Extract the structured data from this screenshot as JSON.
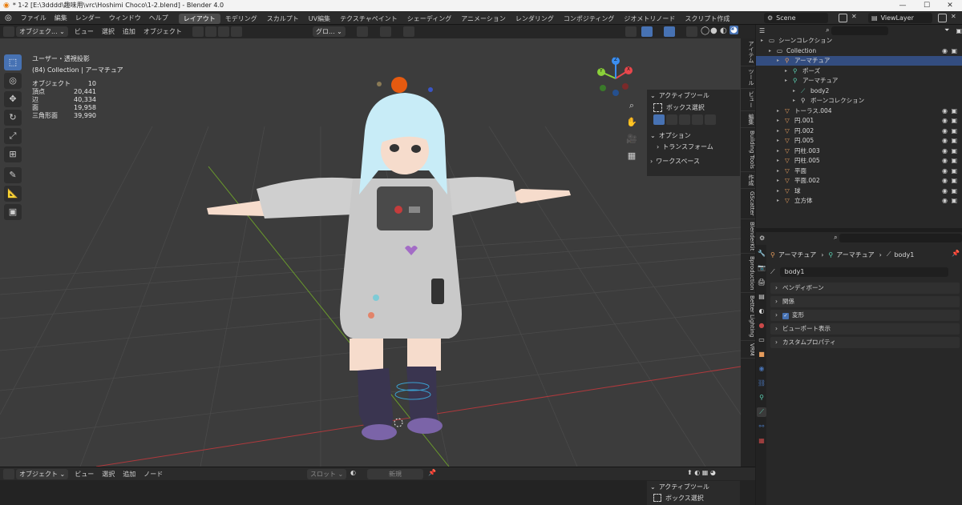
{
  "window": {
    "title": "* 1-2 [E:\\3dddd\\趣味用\\vrc\\Hoshimi Choco\\1-2.blend] - Blender 4.0",
    "minimize": "—",
    "maximize": "☐",
    "close": "✕"
  },
  "menu": [
    "ファイル",
    "編集",
    "レンダー",
    "ウィンドウ",
    "ヘルプ"
  ],
  "workspaces": [
    "レイアウト",
    "モデリング",
    "スカルプト",
    "UV編集",
    "テクスチャペイント",
    "シェーディング",
    "アニメーション",
    "レンダリング",
    "コンポジティング",
    "ジオメトリノード",
    "スクリプト作成"
  ],
  "active_workspace": "レイアウト",
  "scene": {
    "name": "Scene",
    "view_layer": "ViewLayer"
  },
  "viewport_header": {
    "mode": "オブジェク...",
    "menus": [
      "ビュー",
      "選択",
      "追加",
      "オブジェクト"
    ],
    "orientation": "グロ...",
    "options_label": "オプション"
  },
  "overlay": {
    "view_name": "ユーザー・透視投影",
    "collection_line": "(84) Collection | アーマチュア",
    "stats": [
      {
        "label": "オブジェクト",
        "value": "10"
      },
      {
        "label": "頂点",
        "value": "20,441"
      },
      {
        "label": "辺",
        "value": "40,334"
      },
      {
        "label": "面",
        "value": "19,958"
      },
      {
        "label": "三角形面",
        "value": "39,990"
      }
    ]
  },
  "gizmo": {
    "x": "X",
    "y": "Y",
    "z": "Z"
  },
  "npanel": {
    "active_tool": "アクティブツール",
    "box_select": "ボックス選択",
    "options": "オプション",
    "transform": "トランスフォーム",
    "workspace": "ワークスペース"
  },
  "side_tabs": [
    "アイテム",
    "ツール",
    "ビュー",
    "編集",
    "Building Tools",
    "作成",
    "GScatter",
    "BlenderKit",
    "Bproduction",
    "Better Lighting",
    "VRM"
  ],
  "outliner": {
    "rows": [
      {
        "name": "シーンコレクション",
        "indent": 0,
        "icon": "▭",
        "icon_color": "#cfcfcf"
      },
      {
        "name": "Collection",
        "indent": 1,
        "icon": "▭",
        "icon_color": "#e0e0e0",
        "vis": true
      },
      {
        "name": "アーマチュア",
        "indent": 2,
        "icon": "⚲",
        "icon_color": "#e59c5c",
        "selected": true
      },
      {
        "name": "ポーズ",
        "indent": 3,
        "icon": "⚲",
        "icon_color": "#5dd2b4"
      },
      {
        "name": "アーマチュア",
        "indent": 3,
        "icon": "⚲",
        "icon_color": "#5dd2b4"
      },
      {
        "name": "body2",
        "indent": 4,
        "icon": "⟋",
        "icon_color": "#5dd2b4"
      },
      {
        "name": "ボーンコレクション",
        "indent": 4,
        "icon": "⚲",
        "icon_color": "#cfcfcf"
      },
      {
        "name": "トーラス.004",
        "indent": 2,
        "icon": "▽",
        "icon_color": "#e59c5c",
        "vis": true
      },
      {
        "name": "円.001",
        "indent": 2,
        "icon": "▽",
        "icon_color": "#e59c5c",
        "vis": true
      },
      {
        "name": "円.002",
        "indent": 2,
        "icon": "▽",
        "icon_color": "#e59c5c",
        "vis": true
      },
      {
        "name": "円.005",
        "indent": 2,
        "icon": "▽",
        "icon_color": "#e59c5c",
        "vis": true
      },
      {
        "name": "円柱.003",
        "indent": 2,
        "icon": "▽",
        "icon_color": "#e59c5c",
        "vis": true
      },
      {
        "name": "円柱.005",
        "indent": 2,
        "icon": "▽",
        "icon_color": "#e59c5c",
        "vis": true
      },
      {
        "name": "平面",
        "indent": 2,
        "icon": "▽",
        "icon_color": "#e59c5c",
        "vis": true
      },
      {
        "name": "平面.002",
        "indent": 2,
        "icon": "▽",
        "icon_color": "#e59c5c",
        "vis": true
      },
      {
        "name": "球",
        "indent": 2,
        "icon": "▽",
        "icon_color": "#e59c5c",
        "vis": true
      },
      {
        "name": "立方体",
        "indent": 2,
        "icon": "▽",
        "icon_color": "#e59c5c",
        "vis": true
      }
    ]
  },
  "properties": {
    "breadcrumb": [
      "アーマチュア",
      "アーマチュア",
      "body1"
    ],
    "bone_name": "body1",
    "sections": [
      "ベンディボーン",
      "関係",
      "変形",
      "ビューポート表示",
      "カスタムプロパティ"
    ]
  },
  "bottom": {
    "mode": "オブジェクト",
    "menus": [
      "ビュー",
      "選択",
      "追加",
      "ノード"
    ],
    "slot": "スロット",
    "new_label": "新規",
    "active_tool": "アクティブツール",
    "box_select": "ボックス選択"
  },
  "colors": {
    "accent": "#4772b3",
    "selected_row": "#334d80",
    "viewport_bg": "#3c3c3c",
    "axis_x": "#e8474c",
    "axis_y": "#8bd13a",
    "axis_z": "#3b8ef0"
  }
}
